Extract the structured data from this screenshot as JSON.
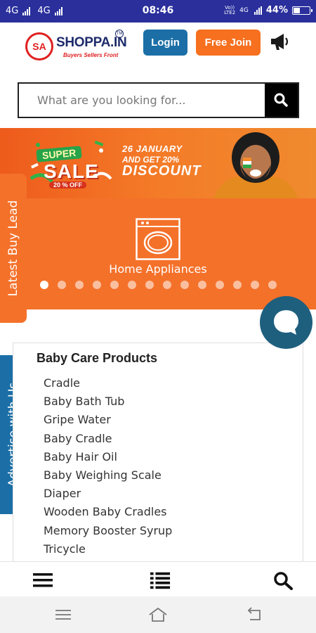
{
  "status_bar": {
    "network_left": "4G",
    "network_right": "4G",
    "time": "08:46",
    "volte_top": "Vo))",
    "volte_bottom": "LTE2",
    "network_4g": "4G",
    "battery_text": "44%",
    "battery_level": 0.44
  },
  "header": {
    "logo_mark": "SA",
    "logo_name": "SHOPPA.IN",
    "logo_tm": "TM",
    "logo_tagline": "Buyers Sellers Front",
    "login_label": "Login",
    "join_label": "Free Join",
    "megaphone_icon": "megaphone-icon"
  },
  "search": {
    "placeholder": "What are you looking for...",
    "icon": "search-icon"
  },
  "banner": {
    "badge_super": "SUPER",
    "badge_sale": "SALE",
    "badge_off": "20 % OFF",
    "line1": "26 JANUARY",
    "line2": "AND GET 20%",
    "line3": "DISCOUNT"
  },
  "slider": {
    "category_label": "Home Appliances",
    "icon": "washing-machine-icon",
    "dot_count": 14,
    "active_dot": 0
  },
  "side_tabs": {
    "buy_lead": "Latest Buy Lead",
    "advertise": "Advertise with Us"
  },
  "list": {
    "title": "Baby Care Products",
    "items": [
      "Cradle",
      "Baby Bath Tub",
      "Gripe Water",
      "Baby Cradle",
      "Baby Hair Oil",
      "Baby Weighing Scale",
      "Diaper",
      "Wooden Baby Cradles",
      "Memory Booster Syrup",
      "Tricycle"
    ]
  },
  "bottom_nav": {
    "menu_icon": "hamburger-menu-icon",
    "list_icon": "list-icon",
    "search_icon": "search-icon"
  },
  "colors": {
    "status_bar": "#2a2f9c",
    "primary_blue": "#1b6fa6",
    "accent_orange": "#f6701f",
    "slider_orange": "#f4712a",
    "chat_teal": "#1e5f7e"
  }
}
